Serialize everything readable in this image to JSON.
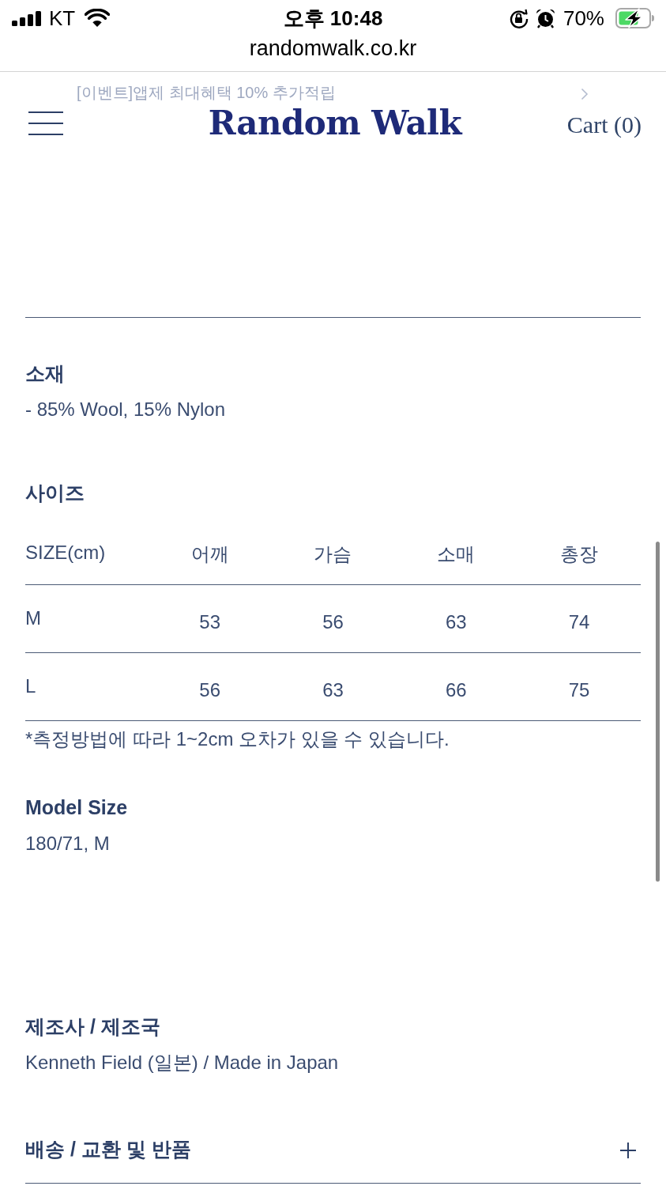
{
  "status_bar": {
    "carrier": "KT",
    "time": "오후 10:48",
    "battery_percent": "70%"
  },
  "address_bar": {
    "url": "randomwalk.co.kr"
  },
  "promo_banner": {
    "text": "[이벤트]앱제 최대혜택 10% 추가적립"
  },
  "header": {
    "logo": "Random Walk",
    "cart": "Cart (0)"
  },
  "sections": [
    {
      "kind": "text",
      "title": "소재",
      "body": "- 85% Wool, 15% Nylon"
    },
    {
      "kind": "table",
      "title": "사이즈",
      "columns": [
        "SIZE(cm)",
        "어깨",
        "가슴",
        "소매",
        "총장"
      ],
      "rows": [
        [
          "M",
          "53",
          "56",
          "63",
          "74"
        ],
        [
          "L",
          "56",
          "63",
          "66",
          "75"
        ]
      ],
      "note": "*측정방법에 따라 1~2cm 오차가 있을 수 있습니다."
    },
    {
      "kind": "text",
      "title": "Model Size",
      "body": "180/71, M"
    },
    {
      "kind": "text",
      "title": "제조사 / 제조국",
      "body": "Kenneth Field (일본) / Made in Japan"
    },
    {
      "kind": "accordion",
      "title": "배송 / 교환 및 반품",
      "expanded": false
    }
  ]
}
